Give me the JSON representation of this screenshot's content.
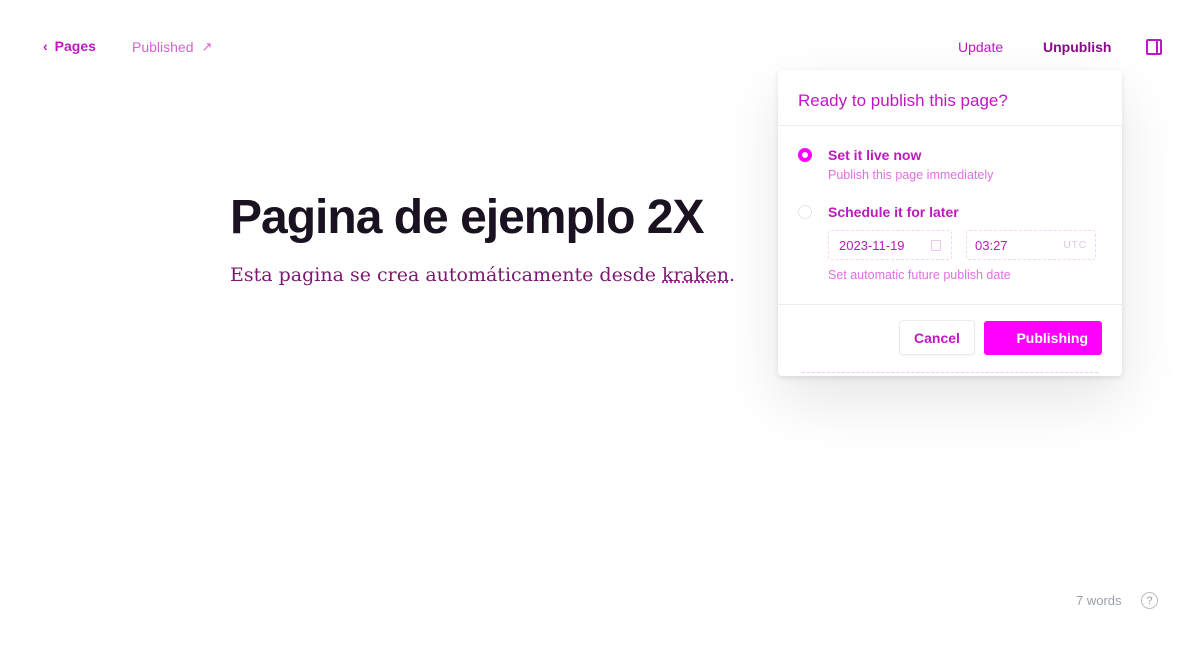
{
  "header": {
    "back_label": "Pages",
    "status_label": "Published",
    "update_label": "Update",
    "unpublish_label": "Unpublish"
  },
  "editor": {
    "title": "Pagina de ejemplo 2X",
    "subtitle_before": "Esta pagina se crea automáticamente desde ",
    "subtitle_spell": "kraken",
    "subtitle_after": "."
  },
  "publish_modal": {
    "heading": "Ready to publish this page?",
    "option_now": {
      "title": "Set it live now",
      "description": "Publish this page immediately",
      "selected": true
    },
    "option_later": {
      "title": "Schedule it for later",
      "date": "2023-11-19",
      "time": "03:27",
      "timezone": "UTC",
      "description": "Set automatic future publish date",
      "selected": false
    },
    "cancel_label": "Cancel",
    "publish_label": "Publishing"
  },
  "footer": {
    "word_count": "7 words",
    "help_glyph": "?"
  },
  "colors": {
    "accent": "#ff00ff",
    "accent_text": "#c018c0",
    "title_text": "#1a1220",
    "muted": "#9aa0a8"
  }
}
